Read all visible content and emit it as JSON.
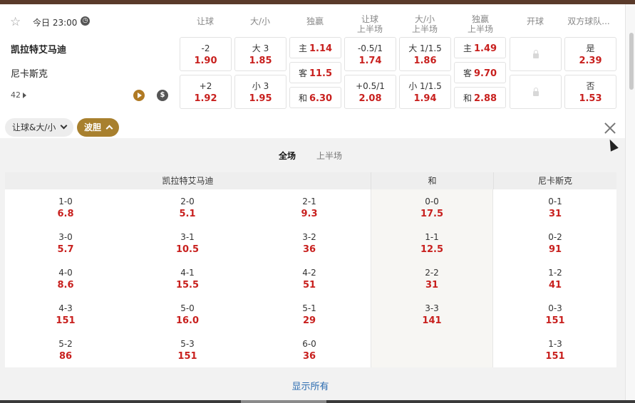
{
  "match": {
    "time": "今日 23:00",
    "home_team": "凯拉特艾马迪",
    "away_team": "尼卡斯克",
    "market_count": "42"
  },
  "columns": [
    {
      "label": "让球"
    },
    {
      "label": "大/小"
    },
    {
      "label": "独赢"
    },
    {
      "label": "让球",
      "sub": "上半场"
    },
    {
      "label": "大/小",
      "sub": "上半场"
    },
    {
      "label": "独赢",
      "sub": "上半场"
    },
    {
      "label": "开球"
    },
    {
      "label": "双方球队..."
    }
  ],
  "odds": {
    "handicap": [
      {
        "line": "-2",
        "odd": "1.90"
      },
      {
        "line": "+2",
        "odd": "1.92"
      }
    ],
    "total": [
      {
        "line": "大 3",
        "odd": "1.85"
      },
      {
        "line": "小 3",
        "odd": "1.95"
      }
    ],
    "moneyline": [
      {
        "label": "主",
        "odd": "1.14"
      },
      {
        "label": "客",
        "odd": "11.5"
      },
      {
        "label": "和",
        "odd": "6.30"
      }
    ],
    "handicap_1h": [
      {
        "line": "-0.5/1",
        "odd": "1.74"
      },
      {
        "line": "+0.5/1",
        "odd": "2.08"
      }
    ],
    "total_1h": [
      {
        "line": "大 1/1.5",
        "odd": "1.86"
      },
      {
        "line": "小 1/1.5",
        "odd": "1.94"
      }
    ],
    "moneyline_1h": [
      {
        "label": "主",
        "odd": "1.49"
      },
      {
        "label": "客",
        "odd": "9.70"
      },
      {
        "label": "和",
        "odd": "2.88"
      }
    ],
    "btts": [
      {
        "line": "是",
        "odd": "2.39"
      },
      {
        "line": "否",
        "odd": "1.53"
      }
    ]
  },
  "filters": {
    "handicap_total": "让球&大/小",
    "correct_score": "波胆"
  },
  "tabs": {
    "full": "全场",
    "first_half": "上半场"
  },
  "groups": {
    "home": "凯拉特艾马迪",
    "draw": "和",
    "away": "尼卡斯克"
  },
  "scores": {
    "home_col1": [
      {
        "s": "1-0",
        "o": "6.8"
      },
      {
        "s": "3-0",
        "o": "5.7"
      },
      {
        "s": "4-0",
        "o": "8.6"
      },
      {
        "s": "4-3",
        "o": "151"
      },
      {
        "s": "5-2",
        "o": "86"
      }
    ],
    "home_col2": [
      {
        "s": "2-0",
        "o": "5.1"
      },
      {
        "s": "3-1",
        "o": "10.5"
      },
      {
        "s": "4-1",
        "o": "15.5"
      },
      {
        "s": "5-0",
        "o": "16.0"
      },
      {
        "s": "5-3",
        "o": "151"
      }
    ],
    "home_col3": [
      {
        "s": "2-1",
        "o": "9.3"
      },
      {
        "s": "3-2",
        "o": "36"
      },
      {
        "s": "4-2",
        "o": "51"
      },
      {
        "s": "5-1",
        "o": "29"
      },
      {
        "s": "6-0",
        "o": "36"
      }
    ],
    "draw": [
      {
        "s": "0-0",
        "o": "17.5"
      },
      {
        "s": "1-1",
        "o": "12.5"
      },
      {
        "s": "2-2",
        "o": "31"
      },
      {
        "s": "3-3",
        "o": "141"
      }
    ],
    "away": [
      {
        "s": "0-1",
        "o": "31"
      },
      {
        "s": "0-2",
        "o": "91"
      },
      {
        "s": "1-2",
        "o": "41"
      },
      {
        "s": "0-3",
        "o": "151"
      },
      {
        "s": "1-3",
        "o": "151"
      }
    ]
  },
  "show_all": "显示所有",
  "colors": {
    "odd_red": "#c8201e",
    "gold": "#a8802e",
    "link_blue": "#2a6bb0"
  }
}
